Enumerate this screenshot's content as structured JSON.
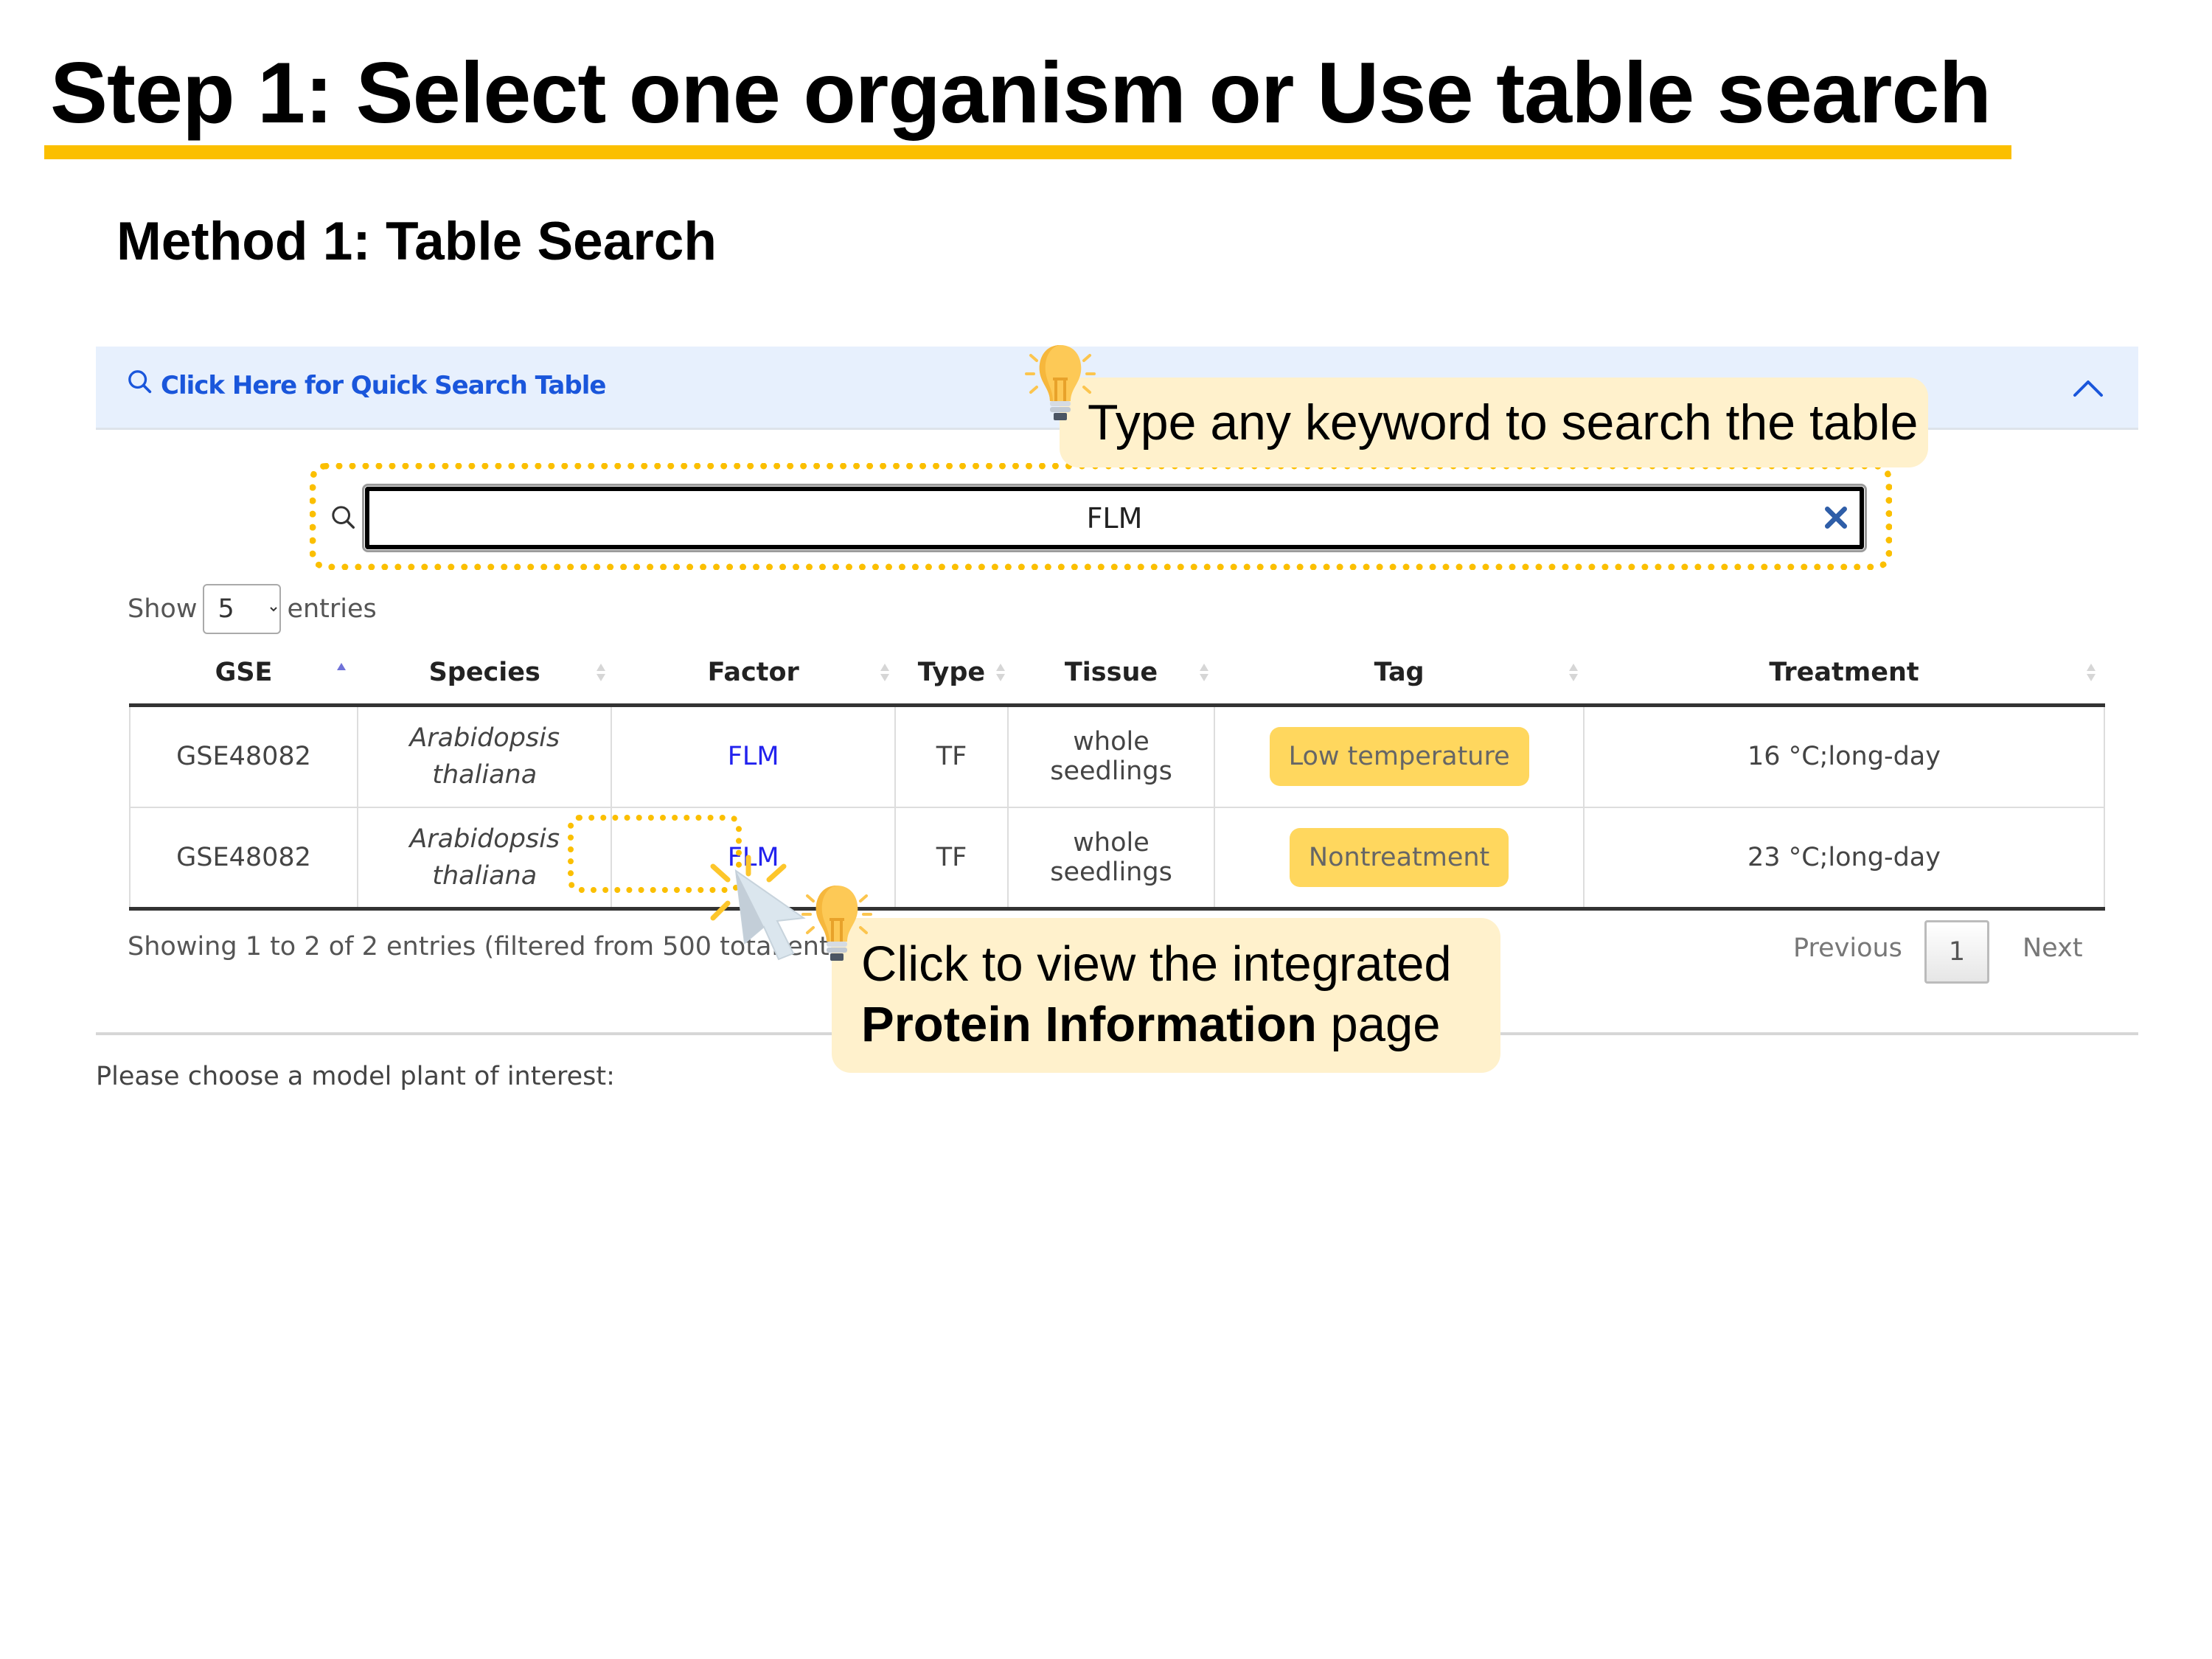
{
  "slide": {
    "title": "Step 1: Select one organism or Use table search",
    "method_heading": "Method 1: Table Search",
    "accent_color": "#fbbf00"
  },
  "quick_search": {
    "link_label": "Click Here for Quick Search Table",
    "icon": "search-icon",
    "collapse_icon": "chevron-up-icon",
    "panel_color": "#e7f0fd",
    "link_color": "#1a56db"
  },
  "search": {
    "value": "FLM",
    "icon": "search-icon",
    "clear_icon": "close-icon"
  },
  "length_menu": {
    "prefix": "Show",
    "selected": "5",
    "suffix": "entries"
  },
  "table": {
    "columns": [
      {
        "label": "GSE",
        "sort": "ascending"
      },
      {
        "label": "Species",
        "sort": "none"
      },
      {
        "label": "Factor",
        "sort": "none"
      },
      {
        "label": "Type",
        "sort": "none"
      },
      {
        "label": "Tissue",
        "sort": "none"
      },
      {
        "label": "Tag",
        "sort": "none"
      },
      {
        "label": "Treatment",
        "sort": "none"
      }
    ],
    "rows": [
      {
        "gse": "GSE48082",
        "species": "Arabidopsis thaliana",
        "factor": "FLM",
        "type": "TF",
        "tissue": "whole seedlings",
        "tag": "Low temperature",
        "treatment": "16 °C;long-day"
      },
      {
        "gse": "GSE48082",
        "species": "Arabidopsis thaliana",
        "factor": "FLM",
        "type": "TF",
        "tissue": "whole seedlings",
        "tag": "Nontreatment",
        "treatment": "23 °C;long-day"
      }
    ],
    "tag_color": "#ffd75e",
    "link_color": "#2222ee"
  },
  "footer": {
    "info": "Showing 1 to 2 of 2 entries (filtered from 500 total entries)",
    "previous": "Previous",
    "current_page": "1",
    "next": "Next"
  },
  "choose_prompt": "Please choose a model plant of interest:",
  "callouts": {
    "search_tip": "Type any keyword to search the table",
    "click_tip_line1": "Click to view the integrated",
    "click_tip_bold": "Protein Information",
    "click_tip_tail": " page",
    "bg_color": "#fff1cc"
  }
}
